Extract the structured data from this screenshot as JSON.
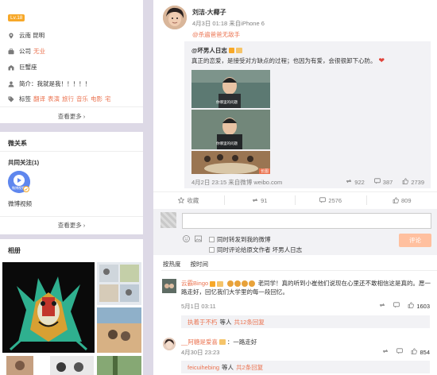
{
  "profile": {
    "level": "Lv.18",
    "location": "云南 昆明",
    "company_prefix": "公司",
    "company": "无业",
    "city": "巨蟹座",
    "bio": "简介：我就是我！！！！！",
    "tags_prefix": "标签",
    "tags": [
      "翻译",
      "表演",
      "旅行",
      "音乐",
      "电影",
      "宅"
    ],
    "more": "查看更多 ›"
  },
  "relations": {
    "title": "微关系",
    "common_follow": "共同关注(1)",
    "follow_name": "微博视频",
    "avatar_text": "微博视频",
    "more": "查看更多 ›"
  },
  "album": {
    "title": "相册"
  },
  "post": {
    "author": "刘洁-大椰子",
    "meta": "4月3日 01:18 来自iPhone 6",
    "mention": "@杀遍爸爸无敌手",
    "repost": {
      "author": "@坏男人日志",
      "text": "真正的恋爱，是接受对方缺点的过程；也因为有爱，会很很卸下心防。",
      "thumb_caption_1": "你哪里的问题",
      "thumb_caption_2": "你哪里的问题",
      "badge": "长图",
      "meta": "4月2日 23:15 来自微博 weibo.com",
      "reposts": "922",
      "comments": "387",
      "likes": "2739"
    },
    "actions": {
      "favorite": "收藏",
      "repost": "91",
      "comment": "2576",
      "like": "809"
    }
  },
  "composer": {
    "placeholder": "",
    "opt_repost": "同时转发到我的微博",
    "opt_comment_to": "同时评论给原文作者 坏男人日志",
    "submit": "评论"
  },
  "comments": {
    "tabs": [
      "按热度",
      "按时间"
    ],
    "items": [
      {
        "user": "云霸Bingo",
        "text": "老同学！真的听到小崔他们说现在心里还不敢相信这是真的。愿一路走好，回忆我们大学里的每一段回忆。",
        "time": "5月1日 03:11",
        "likes": "1603",
        "replies_user": "执着于不朽",
        "replies_text": "等人",
        "replies_link": "共12条回复"
      },
      {
        "user": "__阿糖是爱喜",
        "text": "：一路走好",
        "time": "4月30日 23:23",
        "likes": "854",
        "replies_user": "feicuihebing",
        "replies_text": "等人",
        "replies_link": "共2条回复"
      }
    ]
  }
}
